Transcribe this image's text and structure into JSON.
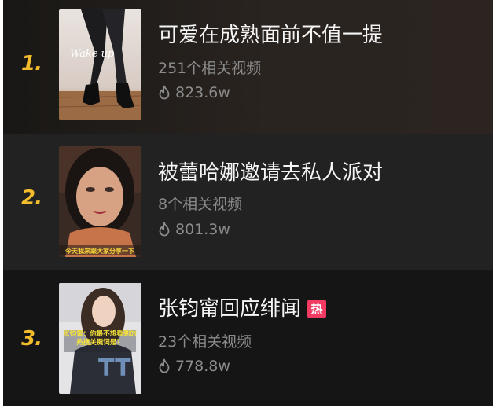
{
  "items": [
    {
      "rank": "1.",
      "title": "可爱在成熟面前不值一提",
      "videos": "251个相关视频",
      "heat": "823.6w",
      "hot": false,
      "thumb_text": "Wake up"
    },
    {
      "rank": "2.",
      "title": "被蕾哈娜邀请去私人派对",
      "videos": "8个相关视频",
      "heat": "801.3w",
      "hot": false,
      "thumb_text": "今天我来跟大家分享一下"
    },
    {
      "rank": "3.",
      "title": "张钧甯回应绯闻",
      "videos": "23个相关视频",
      "heat": "778.8w",
      "hot": true,
      "hot_label": "热",
      "thumb_text": "张钧甯：你最不想看到的热搜关键词是？"
    }
  ],
  "icons": {
    "heat": "flame-icon",
    "hot": "hot-badge"
  },
  "colors": {
    "rank": "#f2bc2d",
    "title": "#f5f5f5",
    "meta": "#8a8a8a",
    "hot_badge": "#f23a63"
  }
}
